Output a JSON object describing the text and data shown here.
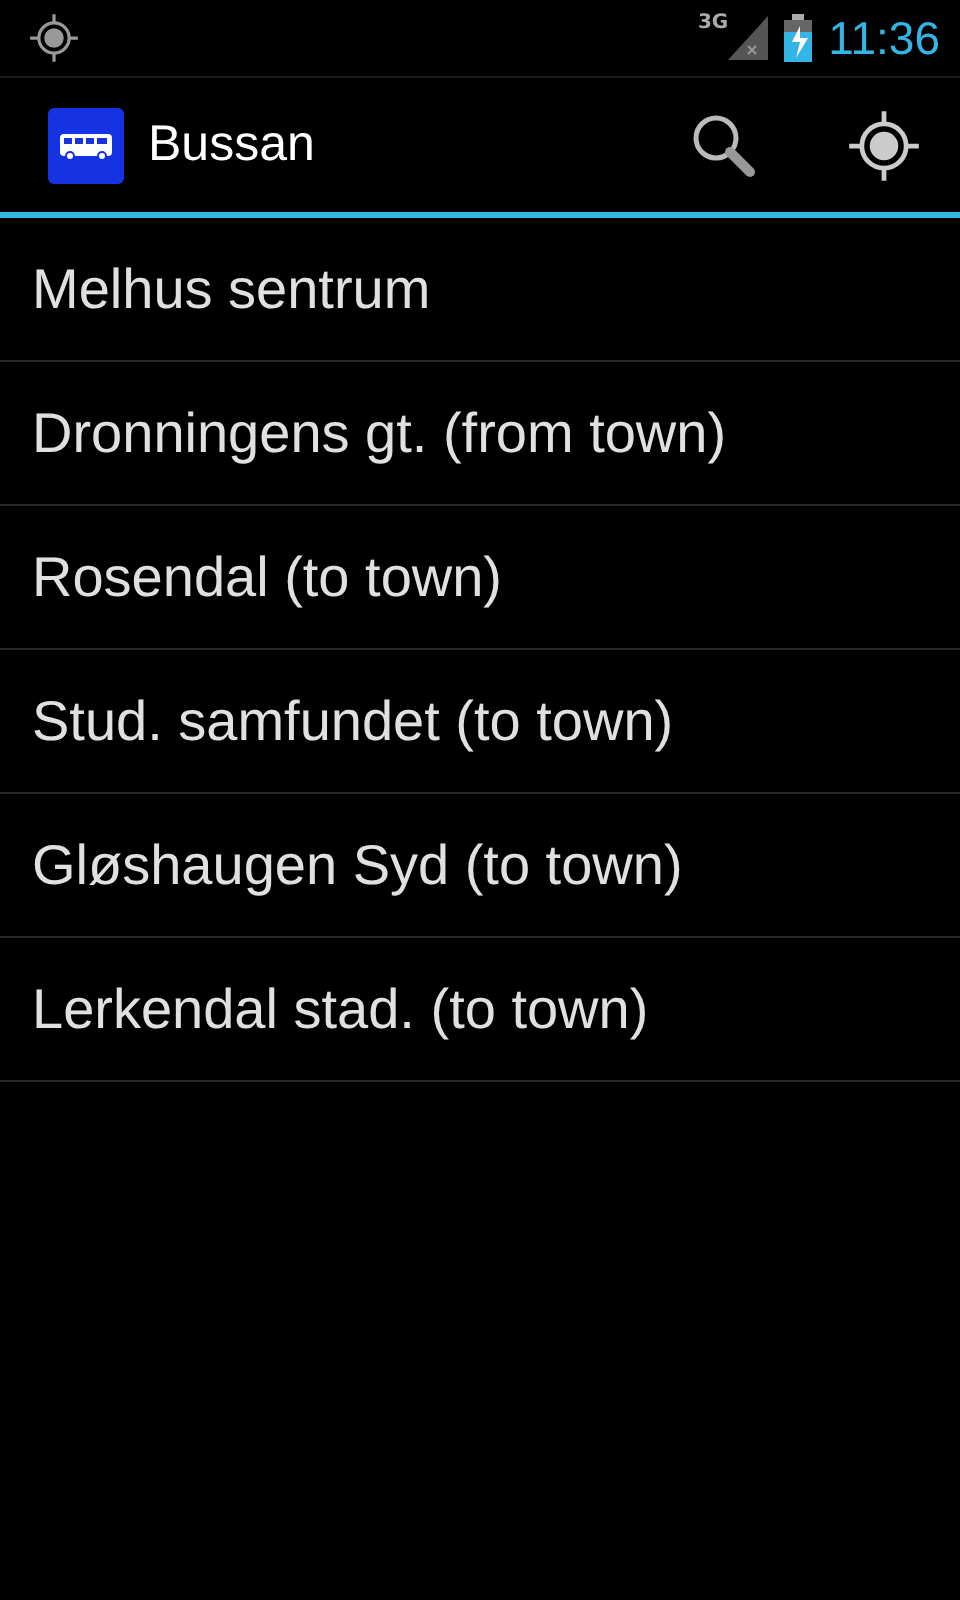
{
  "status_bar": {
    "network": "3G",
    "time": "11:36"
  },
  "action_bar": {
    "title": "Bussan"
  },
  "stops": [
    {
      "label": "Melhus sentrum"
    },
    {
      "label": "Dronningens gt. (from town)"
    },
    {
      "label": "Rosendal (to town)"
    },
    {
      "label": "Stud. samfundet (to town)"
    },
    {
      "label": "Gløshaugen Syd (to town)"
    },
    {
      "label": "Lerkendal stad. (to town)"
    }
  ]
}
